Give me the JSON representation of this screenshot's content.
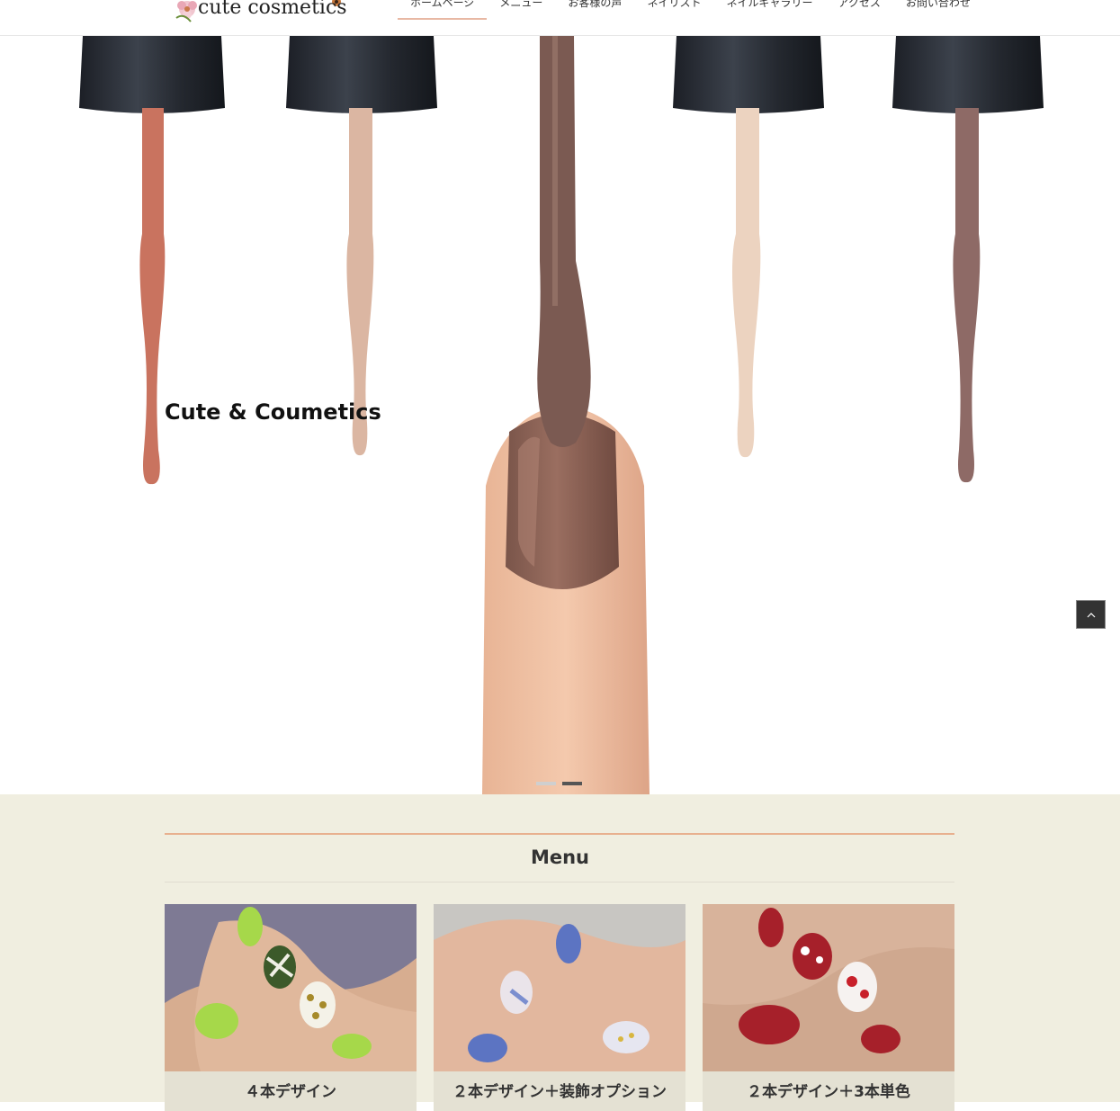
{
  "header": {
    "logo_text": "cute cosmetics",
    "nav": [
      {
        "label": "ホームページ",
        "active": true
      },
      {
        "label": "メニュー",
        "active": false
      },
      {
        "label": "お客様の声",
        "active": false
      },
      {
        "label": "ネイリスト",
        "active": false
      },
      {
        "label": "ネイルギャラリー",
        "active": false
      },
      {
        "label": "アクセス",
        "active": false
      },
      {
        "label": "お問い合わせ",
        "active": false
      }
    ]
  },
  "hero": {
    "caption": "Cute & Coumetics",
    "slides": 2,
    "active_slide": 2
  },
  "menu": {
    "title": "Menu",
    "cards": [
      {
        "title": "４本デザイン"
      },
      {
        "title": "２本デザイン＋装飾オプション"
      },
      {
        "title": "２本デザイン＋3本単色"
      }
    ]
  },
  "colors": {
    "accent": "#e8b08f",
    "section_bg": "#f0eee0",
    "card_bg": "#e4e1d3"
  }
}
